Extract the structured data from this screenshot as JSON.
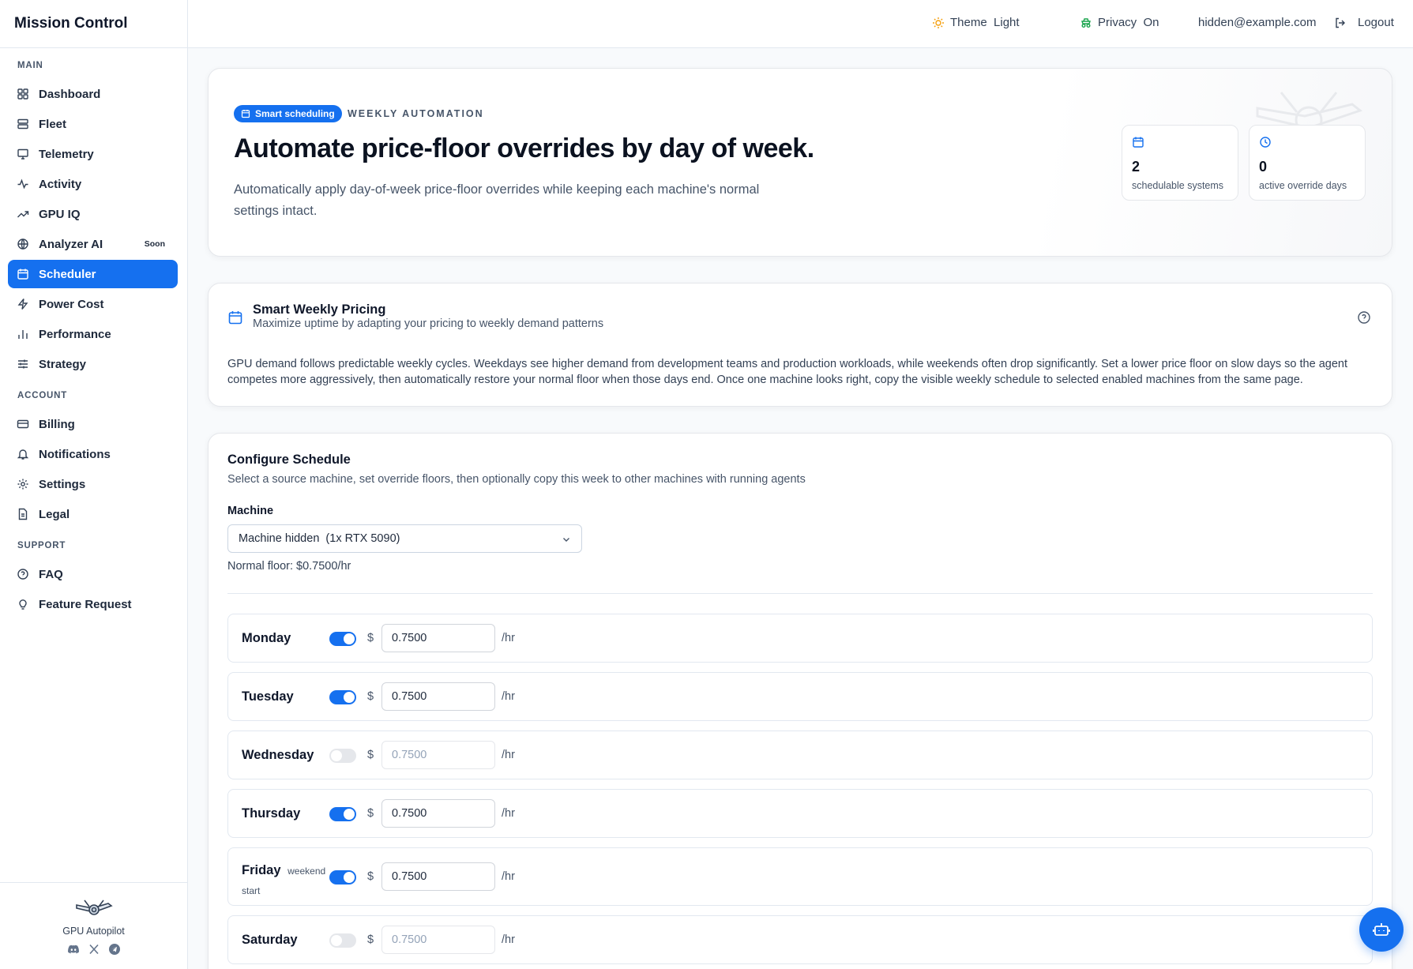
{
  "app": {
    "title": "Mission Control"
  },
  "sidebar": {
    "sections": {
      "main": "MAIN",
      "account": "ACCOUNT",
      "support": "SUPPORT"
    },
    "items": [
      {
        "label": "Dashboard",
        "icon": "grid-icon"
      },
      {
        "label": "Fleet",
        "icon": "server-icon"
      },
      {
        "label": "Telemetry",
        "icon": "monitor-icon"
      },
      {
        "label": "Activity",
        "icon": "pulse-icon"
      },
      {
        "label": "GPU IQ",
        "icon": "trending-up-icon"
      },
      {
        "label": "Analyzer AI",
        "icon": "globe-icon",
        "badge": "Soon"
      },
      {
        "label": "Scheduler",
        "icon": "calendar-icon",
        "active": true
      },
      {
        "label": "Power Cost",
        "icon": "bolt-icon"
      },
      {
        "label": "Performance",
        "icon": "bar-chart-icon"
      },
      {
        "label": "Strategy",
        "icon": "sliders-icon"
      },
      {
        "label": "Billing",
        "icon": "credit-card-icon"
      },
      {
        "label": "Notifications",
        "icon": "bell-icon"
      },
      {
        "label": "Settings",
        "icon": "gear-icon"
      },
      {
        "label": "Legal",
        "icon": "document-icon"
      },
      {
        "label": "FAQ",
        "icon": "help-circle-icon"
      },
      {
        "label": "Feature Request",
        "icon": "lightbulb-icon"
      }
    ],
    "footer": {
      "name": "GPU Autopilot"
    }
  },
  "topbar": {
    "theme": "Theme  Light",
    "privacy": "Privacy  On",
    "email": "hidden@example.com",
    "logout": "Logout"
  },
  "hero": {
    "pill": "Smart scheduling",
    "eyebrow": "WEEKLY AUTOMATION",
    "title": "Automate price-floor overrides by day of week.",
    "description": "Automatically apply day-of-week price-floor overrides while keeping each machine's normal settings intact.",
    "stats": [
      {
        "value": "2",
        "label": "schedulable systems"
      },
      {
        "value": "0",
        "label": "active override days"
      }
    ]
  },
  "info": {
    "title": "Smart Weekly Pricing",
    "subtitle": "Maximize uptime by adapting your pricing to weekly demand patterns",
    "description": "GPU demand follows predictable weekly cycles. Weekdays see higher demand from development teams and production workloads, while weekends often drop significantly. Set a lower price floor on slow days so the agent competes more aggressively, then automatically restore your normal floor when those days end. Once one machine looks right, copy the visible weekly schedule to selected enabled machines from the same page."
  },
  "config": {
    "title": "Configure Schedule",
    "subtitle": "Select a source machine, set override floors, then optionally copy this week to other machines with running agents",
    "machine_label": "Machine",
    "machine_value": "Machine hidden  (1x RTX 5090)",
    "normal_floor": "Normal floor: $0.7500/hr",
    "currency": "$",
    "unit": "/hr",
    "days": [
      {
        "name": "Monday",
        "note": "",
        "enabled": true,
        "value": "0.7500"
      },
      {
        "name": "Tuesday",
        "note": "",
        "enabled": true,
        "value": "0.7500"
      },
      {
        "name": "Wednesday",
        "note": "",
        "enabled": false,
        "value": "0.7500"
      },
      {
        "name": "Thursday",
        "note": "",
        "enabled": true,
        "value": "0.7500"
      },
      {
        "name": "Friday",
        "note": "weekend start",
        "enabled": true,
        "value": "0.7500"
      },
      {
        "name": "Saturday",
        "note": "",
        "enabled": false,
        "value": "0.7500"
      }
    ]
  },
  "colors": {
    "accent": "#1570ef",
    "text": "#0f172a",
    "muted": "#475569",
    "border": "#e2e8f0"
  }
}
